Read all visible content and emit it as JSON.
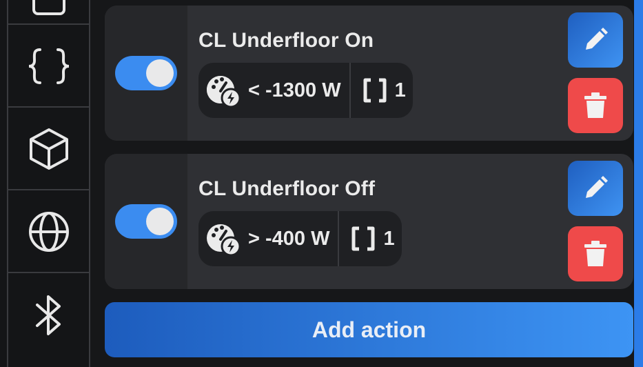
{
  "sidebar": {
    "items": [
      {
        "icon": "tablet-icon"
      },
      {
        "icon": "braces-icon"
      },
      {
        "icon": "cube-icon"
      },
      {
        "icon": "globe-icon"
      },
      {
        "icon": "bluetooth-icon"
      }
    ]
  },
  "rules": [
    {
      "title": "CL Underfloor On",
      "enabled": true,
      "condition": "< -1300 W",
      "action_count": "1"
    },
    {
      "title": "CL Underfloor Off",
      "enabled": true,
      "condition": "> -400 W",
      "action_count": "1"
    }
  ],
  "add_action_label": "Add action",
  "colors": {
    "accent": "#3b8cf0",
    "danger": "#ef4a4a",
    "card": "#2f3034",
    "background": "#161719"
  }
}
